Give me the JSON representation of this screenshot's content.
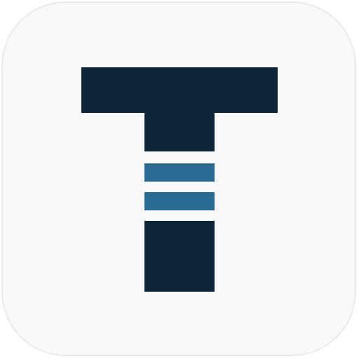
{
  "app_icon": {
    "name": "T logo app icon",
    "colors": {
      "background": "#f8f9fb",
      "border": "#e8eaec",
      "primary": "#0d263a",
      "accent": "#2b6b93"
    }
  }
}
